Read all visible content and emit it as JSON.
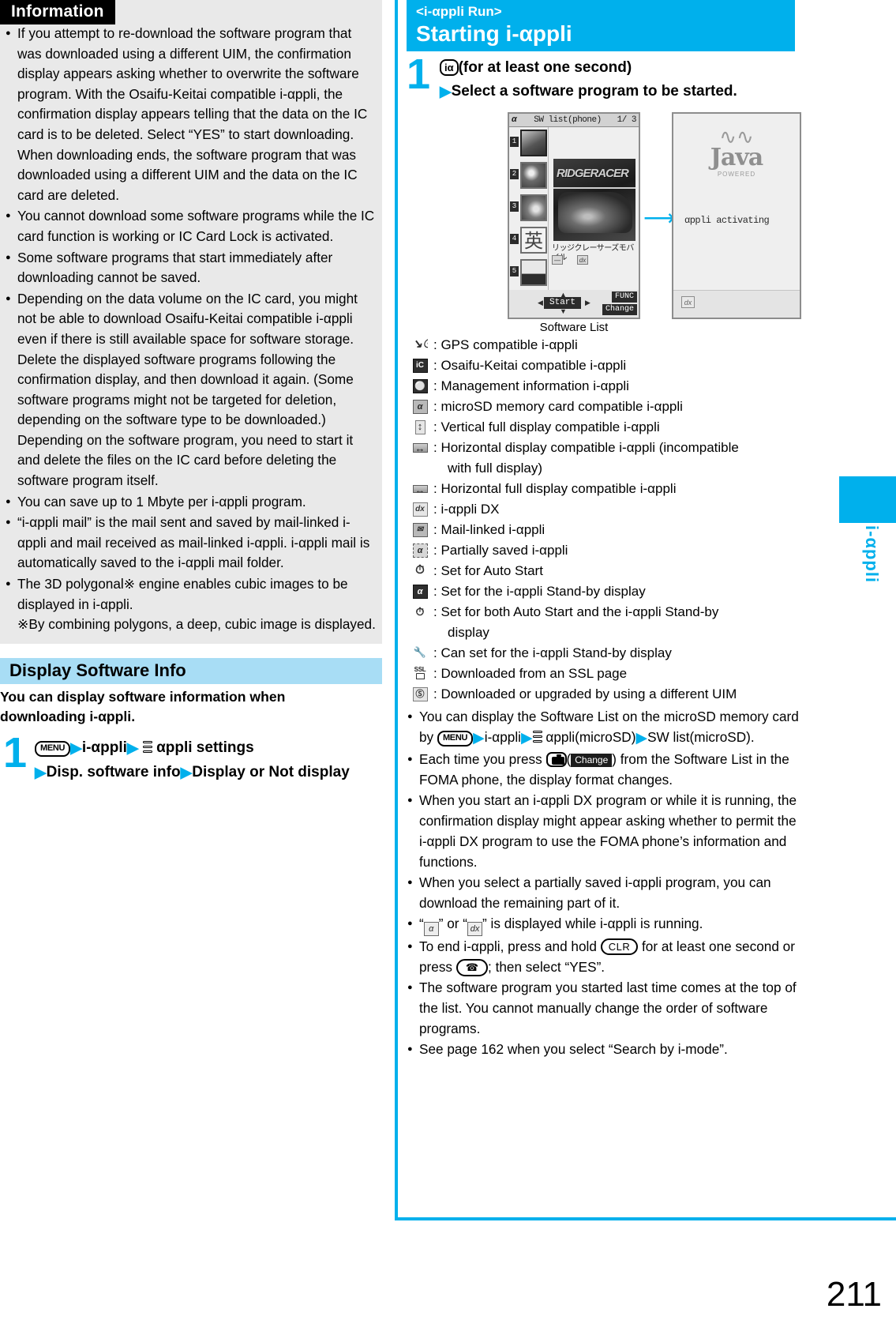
{
  "left": {
    "info_title": "Information",
    "bullets": [
      "If you attempt to re-download the software program that was downloaded using a different UIM, the confirmation display appears asking whether to overwrite the software program. With the Osaifu-Keitai compatible i-αppli, the confirmation display appears telling that the data on the IC card is to be deleted. Select “YES” to start downloading. When downloading ends, the software program that was downloaded using a different UIM and the data on the IC card are deleted.",
      "You cannot download some software programs while the IC card function is working or IC Card Lock is activated.",
      "Some software programs that start immediately after downloading cannot be saved.",
      "Depending on the data volume on the IC card, you might not be able to download Osaifu-Keitai compatible i-αppli even if there is still available space for software storage. Delete the displayed software programs following the confirmation display, and then download it again. (Some software programs might not be targeted for deletion, depending on the software type to be downloaded.) Depending on the software program, you need to start it and delete the files on the IC card before deleting the software program itself.",
      "You can save up to 1 Mbyte per i-αppli program.",
      "“i-αppli mail” is the mail sent and saved by mail-linked i-αppli and mail received as mail-linked i-αppli. i-αppli mail is automatically saved to the i-αppli mail folder.",
      "The 3D polygonal※ engine enables cubic images to be displayed in i-αppli."
    ],
    "footnote": "※By combining polygons, a deep, cubic image is displayed.",
    "section_heading": "Display Software Info",
    "section_lead": "You can display software information when downloading i-αppli.",
    "step": {
      "number": "1",
      "menu_key": "MENU",
      "line1_part1": "i-αppli",
      "line1_part2": "αppli settings",
      "line2_part1": "Disp. software info",
      "line2_part2": "Display or Not display"
    }
  },
  "right": {
    "chapter_sub": "<i-αppli Run>",
    "chapter_title": "Starting i-αppli",
    "step": {
      "number": "1",
      "key_label": "iα",
      "line1": "(for at least one second)",
      "line2": "Select a software program to be started."
    },
    "screenshot": {
      "titlebar_left": "α",
      "titlebar_mid": "SW list(phone)",
      "titlebar_right": "1/ 3",
      "item_numbers": [
        "1",
        "2",
        "3",
        "4",
        "5"
      ],
      "item4_glyph": "英",
      "preview_title": "RIDGERACER",
      "software_name": "リッジクレーサーズモバイル",
      "softkey_func": "FUNC",
      "softkey_change": "Change",
      "center_key": "Start",
      "caption": "Software List",
      "java_word": "Java",
      "java_powered": "POWERED",
      "activating_msg": "αppli activating",
      "dx_badge": "dx"
    },
    "legend": [
      {
        "icon": "gps-icon",
        "text": "GPS compatible i-αppli"
      },
      {
        "icon": "ic-card-icon",
        "text": "Osaifu-Keitai compatible i-αppli"
      },
      {
        "icon": "management-info-icon",
        "text": "Management information i-αppli"
      },
      {
        "icon": "microsd-icon",
        "text": "microSD memory card compatible i-αppli"
      },
      {
        "icon": "vertical-full-display-icon",
        "text": "Vertical full display compatible i-αppli"
      },
      {
        "icon": "horizontal-display-icon",
        "text": "Horizontal display compatible i-αppli (incompatible",
        "cont": "with full display)"
      },
      {
        "icon": "horizontal-full-display-icon",
        "text": "Horizontal full display compatible i-αppli"
      },
      {
        "icon": "iappli-dx-icon",
        "text": "i-αppli DX"
      },
      {
        "icon": "mail-linked-icon",
        "text": "Mail-linked i-αppli"
      },
      {
        "icon": "partially-saved-icon",
        "text": "Partially saved i-αppli"
      },
      {
        "icon": "auto-start-icon",
        "text": "Set for Auto Start"
      },
      {
        "icon": "standby-display-icon",
        "text": "Set for the i-αppli Stand-by display"
      },
      {
        "icon": "auto-start-standby-icon",
        "text": "Set for both Auto Start and the i-αppli Stand-by",
        "cont": "display"
      },
      {
        "icon": "can-set-standby-icon",
        "text": "Can set for the i-αppli Stand-by display"
      },
      {
        "icon": "ssl-icon",
        "text": "Downloaded from an SSL page"
      },
      {
        "icon": "different-uim-icon",
        "text": "Downloaded or upgraded by using a different UIM"
      }
    ],
    "bullets": [
      {
        "id": "microsd-list",
        "segs": [
          {
            "t": "text",
            "v": "You can display the Software List on the microSD memory card by "
          },
          {
            "t": "key",
            "v": "MENU"
          },
          {
            "t": "arrow"
          },
          {
            "t": "text",
            "v": "i-αppli"
          },
          {
            "t": "arrow"
          },
          {
            "t": "stack"
          },
          {
            "t": "text",
            "v": " αppli(microSD)"
          },
          {
            "t": "arrow"
          },
          {
            "t": "text",
            "v": "SW list(microSD)."
          }
        ]
      },
      {
        "id": "change-format",
        "segs": [
          {
            "t": "text",
            "v": "Each time you press "
          },
          {
            "t": "camkey"
          },
          {
            "t": "text",
            "v": "("
          },
          {
            "t": "blackkey",
            "v": "Change"
          },
          {
            "t": "text",
            "v": ") from the Software List in the FOMA phone, the display format changes."
          }
        ]
      },
      {
        "id": "dx-permission",
        "segs": [
          {
            "t": "text",
            "v": "When you start an i-αppli DX program or while it is running, the confirmation display might appear asking whether to permit the i-αppli DX program to use the FOMA phone’s information and functions."
          }
        ]
      },
      {
        "id": "partially-saved",
        "segs": [
          {
            "t": "text",
            "v": "When you select a partially saved i-αppli program, you can download the remaining part of it."
          }
        ]
      },
      {
        "id": "running-indicator",
        "segs": [
          {
            "t": "text",
            "v": "“"
          },
          {
            "t": "ico",
            "v": "α"
          },
          {
            "t": "text",
            "v": "” or “"
          },
          {
            "t": "ico",
            "v": "dx"
          },
          {
            "t": "text",
            "v": "” is displayed while i-αppli is running."
          }
        ]
      },
      {
        "id": "end-iappli",
        "segs": [
          {
            "t": "text",
            "v": "To end i-αppli, press and hold "
          },
          {
            "t": "roundkey",
            "v": "CLR"
          },
          {
            "t": "text",
            "v": " for at least one second or press "
          },
          {
            "t": "phonekey",
            "v": "☎"
          },
          {
            "t": "text",
            "v": "; then select “YES”."
          }
        ]
      },
      {
        "id": "last-started-top",
        "segs": [
          {
            "t": "text",
            "v": "The software program you started last time comes at the top of the list. You cannot manually change the order of software programs."
          }
        ]
      },
      {
        "id": "search-by-imode",
        "segs": [
          {
            "t": "text",
            "v": "See page 162 when you select “Search by i-mode”."
          }
        ]
      }
    ],
    "side_tab_label": "i-αppli",
    "page_number": "211"
  },
  "colors": {
    "accent": "#00b0ec",
    "section_bar": "#a8ddf5",
    "info_bg": "#e9e9e9"
  }
}
